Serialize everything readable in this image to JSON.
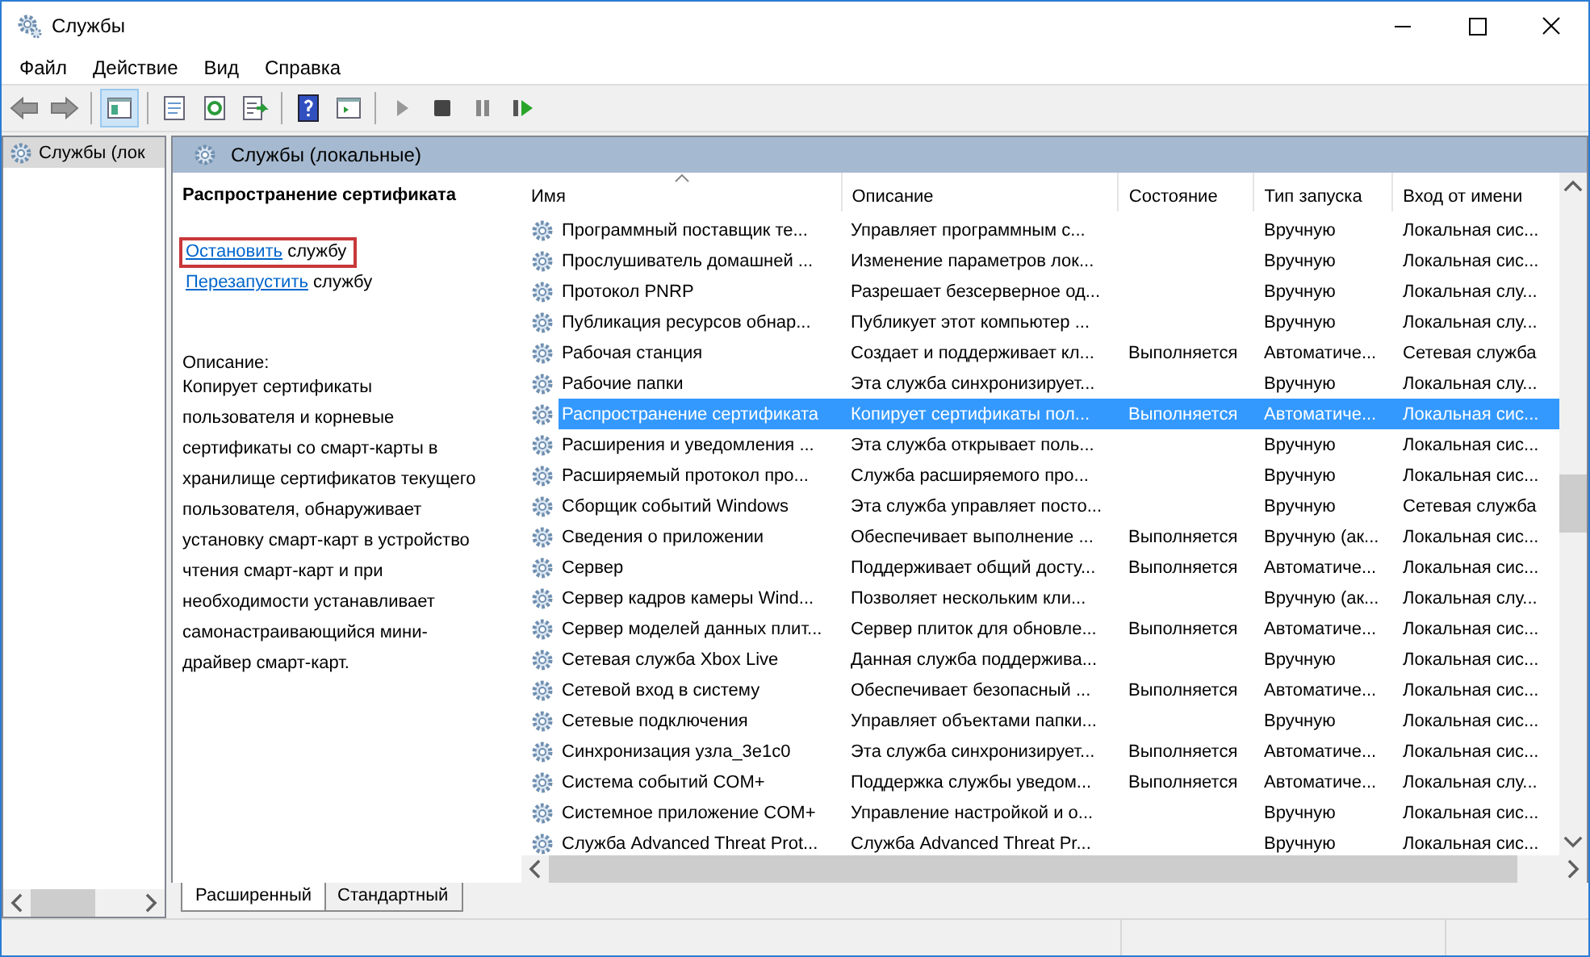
{
  "window": {
    "title": "Службы"
  },
  "menu": [
    "Файл",
    "Действие",
    "Вид",
    "Справка"
  ],
  "toolbar": {
    "console_tree_shown": true
  },
  "tree": {
    "items": [
      {
        "label": "Службы (лок",
        "selected": true
      }
    ]
  },
  "panel": {
    "title": "Службы (локальные)"
  },
  "details": {
    "service_name": "Распространение сертификата",
    "actions": [
      {
        "link": "Остановить",
        "text": "службу",
        "highlighted": true
      },
      {
        "link": "Перезапустить",
        "text": "службу",
        "highlighted": false
      }
    ],
    "description_label": "Описание:",
    "description": "Копирует сертификаты пользователя и корневые сертификаты со смарт-карты в хранилище сертификатов текущего пользователя, обнаруживает установку смарт-карт в устройство чтения смарт-карт и при необходимости устанавливает самонастраивающийся мини-драйвер смарт-карт."
  },
  "table": {
    "columns": [
      {
        "label": "Имя",
        "sorted": true
      },
      {
        "label": "Описание",
        "sorted": false
      },
      {
        "label": "Состояние",
        "sorted": false
      },
      {
        "label": "Тип запуска",
        "sorted": false
      },
      {
        "label": "Вход от имени",
        "sorted": false
      }
    ],
    "rows": [
      {
        "name": "Программный поставщик те...",
        "description": "Управляет программным с...",
        "status": "",
        "startup": "Вручную",
        "logon": "Локальная сис...",
        "selected": false
      },
      {
        "name": "Прослушиватель домашней ...",
        "description": "Изменение параметров лок...",
        "status": "",
        "startup": "Вручную",
        "logon": "Локальная сис...",
        "selected": false
      },
      {
        "name": "Протокол PNRP",
        "description": "Разрешает безсерверное од...",
        "status": "",
        "startup": "Вручную",
        "logon": "Локальная слу...",
        "selected": false
      },
      {
        "name": "Публикация ресурсов обнар...",
        "description": "Публикует этот компьютер ...",
        "status": "",
        "startup": "Вручную",
        "logon": "Локальная слу...",
        "selected": false
      },
      {
        "name": "Рабочая станция",
        "description": "Создает и поддерживает кл...",
        "status": "Выполняется",
        "startup": "Автоматиче...",
        "logon": "Сетевая служба",
        "selected": false
      },
      {
        "name": "Рабочие папки",
        "description": "Эта служба синхронизирует...",
        "status": "",
        "startup": "Вручную",
        "logon": "Локальная слу...",
        "selected": false
      },
      {
        "name": "Распространение сертификата",
        "description": "Копирует сертификаты пол...",
        "status": "Выполняется",
        "startup": "Автоматиче...",
        "logon": "Локальная сис...",
        "selected": true
      },
      {
        "name": "Расширения и уведомления ...",
        "description": "Эта служба открывает поль...",
        "status": "",
        "startup": "Вручную",
        "logon": "Локальная сис...",
        "selected": false
      },
      {
        "name": "Расширяемый протокол про...",
        "description": "Служба расширяемого про...",
        "status": "",
        "startup": "Вручную",
        "logon": "Локальная сис...",
        "selected": false
      },
      {
        "name": "Сборщик событий Windows",
        "description": "Эта служба управляет посто...",
        "status": "",
        "startup": "Вручную",
        "logon": "Сетевая служба",
        "selected": false
      },
      {
        "name": "Сведения о приложении",
        "description": "Обеспечивает выполнение ...",
        "status": "Выполняется",
        "startup": "Вручную (ак...",
        "logon": "Локальная сис...",
        "selected": false
      },
      {
        "name": "Сервер",
        "description": "Поддерживает общий досту...",
        "status": "Выполняется",
        "startup": "Автоматиче...",
        "logon": "Локальная сис...",
        "selected": false
      },
      {
        "name": "Сервер кадров камеры Wind...",
        "description": "Позволяет нескольким кли...",
        "status": "",
        "startup": "Вручную (ак...",
        "logon": "Локальная слу...",
        "selected": false
      },
      {
        "name": "Сервер моделей данных плит...",
        "description": "Сервер плиток для обновле...",
        "status": "Выполняется",
        "startup": "Автоматиче...",
        "logon": "Локальная сис...",
        "selected": false
      },
      {
        "name": "Сетевая служба Xbox Live",
        "description": "Данная служба поддержива...",
        "status": "",
        "startup": "Вручную",
        "logon": "Локальная сис...",
        "selected": false
      },
      {
        "name": "Сетевой вход в систему",
        "description": "Обеспечивает безопасный ...",
        "status": "Выполняется",
        "startup": "Автоматиче...",
        "logon": "Локальная сис...",
        "selected": false
      },
      {
        "name": "Сетевые подключения",
        "description": "Управляет объектами папки...",
        "status": "",
        "startup": "Вручную",
        "logon": "Локальная сис...",
        "selected": false
      },
      {
        "name": "Синхронизация узла_3e1c0",
        "description": "Эта служба синхронизирует...",
        "status": "Выполняется",
        "startup": "Автоматиче...",
        "logon": "Локальная сис...",
        "selected": false
      },
      {
        "name": "Система событий COM+",
        "description": "Поддержка службы уведом...",
        "status": "Выполняется",
        "startup": "Автоматиче...",
        "logon": "Локальная слу...",
        "selected": false
      },
      {
        "name": "Системное приложение COM+",
        "description": "Управление настройкой и о...",
        "status": "",
        "startup": "Вручную",
        "logon": "Локальная сис...",
        "selected": false
      },
      {
        "name": "Служба Advanced Threat Prot...",
        "description": "Служба Advanced Threat Pr...",
        "status": "",
        "startup": "Вручную",
        "logon": "Локальная сис...",
        "selected": false
      }
    ]
  },
  "tabs": [
    {
      "label": "Расширенный",
      "selected": true
    },
    {
      "label": "Стандартный",
      "selected": false
    }
  ]
}
